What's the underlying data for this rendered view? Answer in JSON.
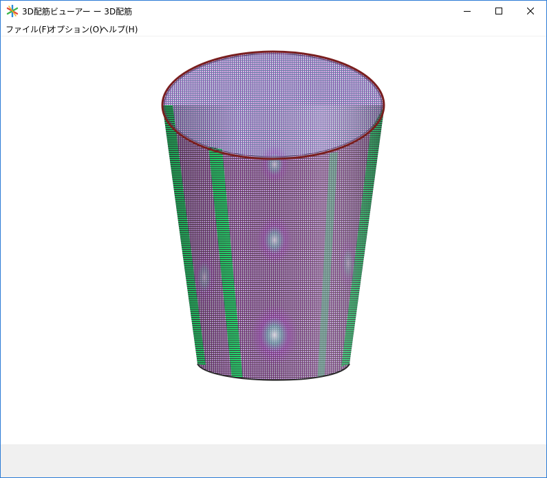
{
  "window": {
    "title": "3D配筋ビューアー ー 3D配筋",
    "icon": "app-asterisk-icon"
  },
  "controls": {
    "minimize_icon": "minimize-icon",
    "maximize_icon": "maximize-icon",
    "close_icon": "close-icon"
  },
  "menu": {
    "file": "ファイル(F)",
    "option": "オプション(O)",
    "help": "ヘルプ(H)"
  },
  "viewport": {
    "model": "cylindrical-rebar-mesh",
    "colors": {
      "rebar_magenta": "#c02ad0",
      "rebar_green": "#22d46a",
      "rebar_dark": "#3a1f2a",
      "rim_red": "#8a1a1a",
      "background": "#ffffff"
    }
  },
  "statusbar": {
    "background": "#f0f0f0"
  }
}
